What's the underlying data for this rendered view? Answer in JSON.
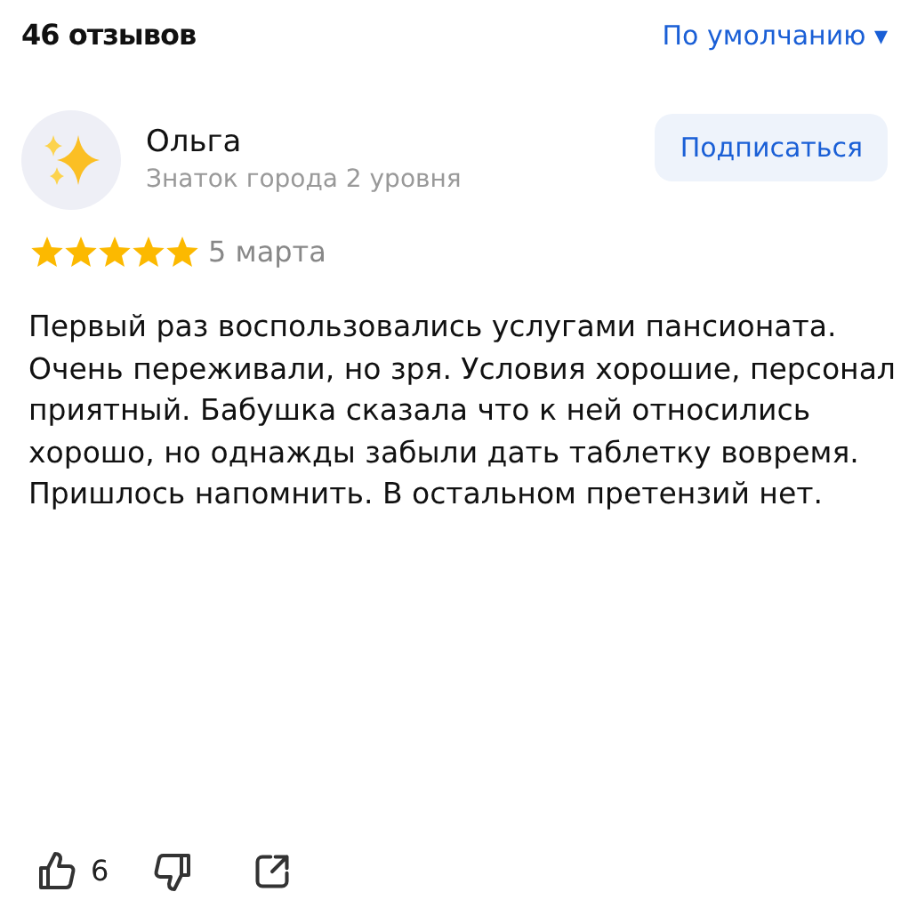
{
  "header": {
    "count": "46 отзывов",
    "sort": "По умолчанию ▾"
  },
  "review": {
    "author": "Ольга",
    "level": "Знаток города 2 уровня",
    "subscribe": "Подписаться",
    "stars": 5,
    "date": "5 марта",
    "text": "Первый раз воспользовались услугами пансионата. Очень переживали, но зря. Условия хорошие, персонал приятный. Бабушка сказала что к ней относились хорошо, но однажды забыли дать таблетку вовремя. Пришлось напомнить. В остальном претензий нет.",
    "likes": "6"
  }
}
